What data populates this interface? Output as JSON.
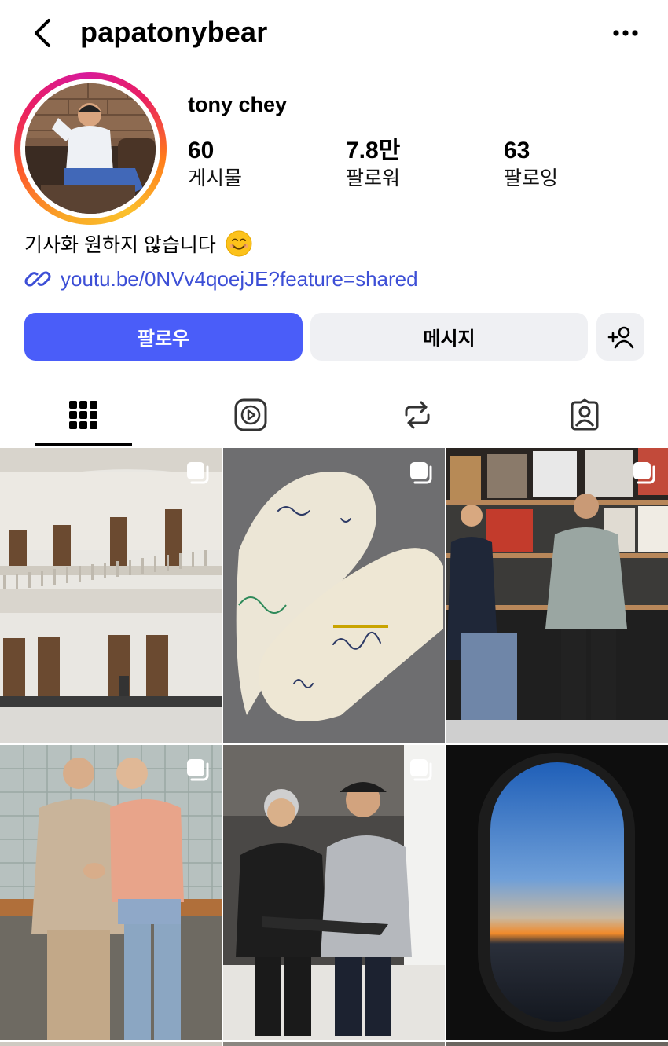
{
  "header": {
    "username": "papatonybear",
    "back_icon": "chevron-left-icon",
    "more_icon": "more-horizontal-icon"
  },
  "profile": {
    "display_name": "tony chey",
    "stats": [
      {
        "value": "60",
        "label": "게시물"
      },
      {
        "value": "7.8만",
        "label": "팔로워"
      },
      {
        "value": "63",
        "label": "팔로잉"
      }
    ],
    "bio": "기사화 원하지 않습니다",
    "bio_emoji": "smiling-face-emoji",
    "link": "youtu.be/0NVv4qoejJE?feature=shared"
  },
  "actions": {
    "follow_label": "팔로우",
    "message_label": "메시지",
    "add_user_icon": "add-person-icon"
  },
  "tabs": [
    {
      "icon": "grid-icon",
      "active": true
    },
    {
      "icon": "reels-icon",
      "active": false
    },
    {
      "icon": "reposts-icon",
      "active": false
    },
    {
      "icon": "tagged-icon",
      "active": false
    }
  ],
  "colors": {
    "accent": "#4a5df9",
    "link": "#3d4fd6",
    "secondary_button": "#eff0f3"
  },
  "posts": [
    {
      "subject": "museum-interior",
      "multi": true
    },
    {
      "subject": "signed-casts",
      "multi": true
    },
    {
      "subject": "record-store",
      "multi": true
    },
    {
      "subject": "handshake",
      "multi": true
    },
    {
      "subject": "two-men-tablet",
      "multi": true
    },
    {
      "subject": "airplane-window",
      "multi": false
    }
  ]
}
